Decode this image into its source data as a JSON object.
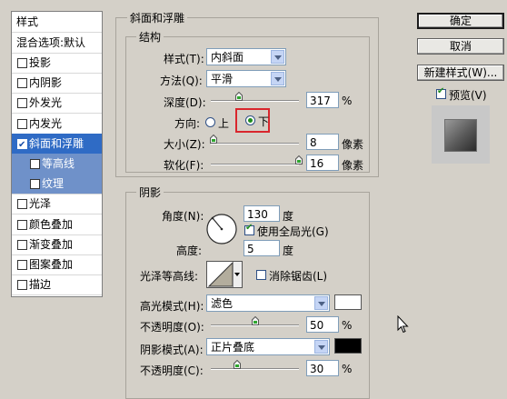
{
  "style_list": {
    "header": "样式",
    "blend": "混合选项:默认",
    "items": [
      {
        "label": "投影",
        "checked": false
      },
      {
        "label": "内阴影",
        "checked": false
      },
      {
        "label": "外发光",
        "checked": false
      },
      {
        "label": "内发光",
        "checked": false
      },
      {
        "label": "斜面和浮雕",
        "checked": true
      },
      {
        "label": "等高线",
        "checked": false
      },
      {
        "label": "纹理",
        "checked": false
      },
      {
        "label": "光泽",
        "checked": false
      },
      {
        "label": "颜色叠加",
        "checked": false
      },
      {
        "label": "渐变叠加",
        "checked": false
      },
      {
        "label": "图案叠加",
        "checked": false
      },
      {
        "label": "描边",
        "checked": false
      }
    ]
  },
  "bevel": {
    "title": "斜面和浮雕",
    "structure_title": "结构",
    "style_label": "样式(T):",
    "style_value": "内斜面",
    "technique_label": "方法(Q):",
    "technique_value": "平滑",
    "depth_label": "深度(D):",
    "depth_value": "317",
    "depth_unit": "%",
    "depth_level": 0.317,
    "direction_label": "方向:",
    "dir_up": "上",
    "dir_down": "下",
    "size_label": "大小(Z):",
    "size_value": "8",
    "size_unit": "像素",
    "size_level": 0.03,
    "soften_label": "软化(F):",
    "soften_value": "16",
    "soften_unit": "像素",
    "soften_level": 1.0
  },
  "shading": {
    "title": "阴影",
    "angle_label": "角度(N):",
    "angle_value": "130",
    "angle_unit": "度",
    "global_light": "使用全局光(G)",
    "altitude_label": "高度:",
    "altitude_value": "5",
    "altitude_unit": "度",
    "gloss_label": "光泽等高线:",
    "anti_alias": "消除锯齿(L)",
    "highlight_mode_label": "高光模式(H):",
    "highlight_mode_value": "滤色",
    "highlight_color": "#ffffff",
    "highlight_opacity_label": "不透明度(O):",
    "highlight_opacity_value": "50",
    "opacity_unit": "%",
    "highlight_opacity_level": 0.5,
    "shadow_mode_label": "阴影模式(A):",
    "shadow_mode_value": "正片叠底",
    "shadow_color": "#000000",
    "shadow_opacity_label": "不透明度(C):",
    "shadow_opacity_value": "30",
    "shadow_opacity_level": 0.3
  },
  "buttons": {
    "ok": "确定",
    "cancel": "取消",
    "new_style": "新建样式(W)...",
    "preview": "预览(V)"
  }
}
